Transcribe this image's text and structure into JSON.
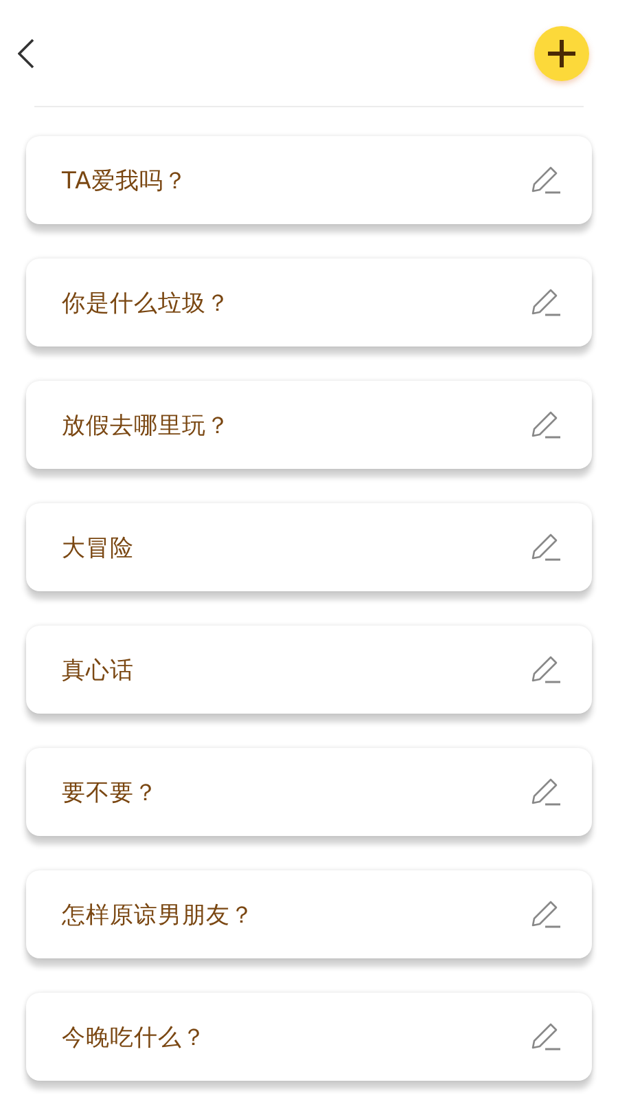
{
  "items": [
    {
      "title": "TA爱我吗？"
    },
    {
      "title": "你是什么垃圾？"
    },
    {
      "title": "放假去哪里玩？"
    },
    {
      "title": "大冒险"
    },
    {
      "title": "真心话"
    },
    {
      "title": "要不要？"
    },
    {
      "title": "怎样原谅男朋友？"
    },
    {
      "title": "今晚吃什么？"
    }
  ]
}
